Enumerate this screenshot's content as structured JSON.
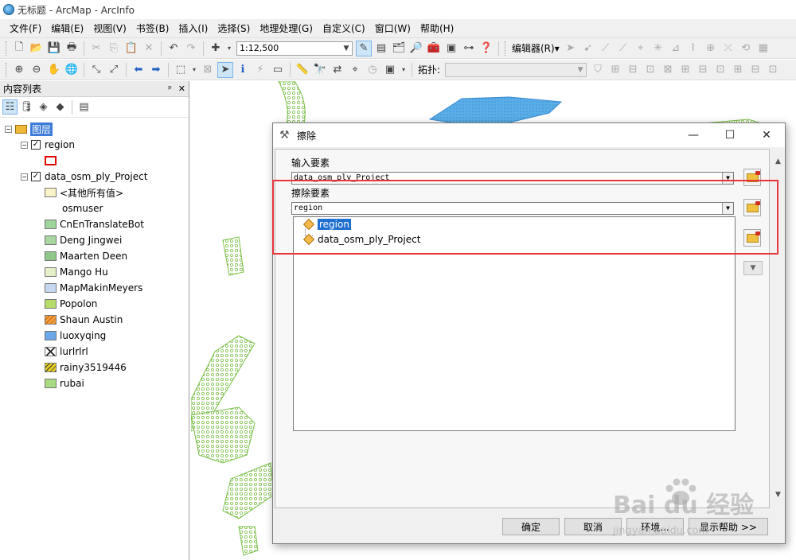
{
  "window": {
    "title": "无标题 - ArcMap - ArcInfo"
  },
  "menubar": {
    "items": [
      "文件(F)",
      "编辑(E)",
      "视图(V)",
      "书签(B)",
      "插入(I)",
      "选择(S)",
      "地理处理(G)",
      "自定义(C)",
      "窗口(W)",
      "帮助(H)"
    ]
  },
  "toolbar": {
    "scale_value": "1:12,500",
    "editor_label": "编辑器(R)▾",
    "topology_label": "拓扑:"
  },
  "toc": {
    "title": "内容列表",
    "pin_glyph": "ᵖ",
    "close_glyph": "✕",
    "root_label": "图层",
    "layer1": "region",
    "layer2": "data_osm_ply_Project",
    "other_values": "<其他所有值>",
    "field_name": "osmuser",
    "legend": [
      {
        "label": "CnEnTranslateBot",
        "color": "#9fd49a"
      },
      {
        "label": "Deng Jingwei",
        "color": "#a8d8a0"
      },
      {
        "label": "Maarten Deen",
        "color": "#8fc98a"
      },
      {
        "label": "Mango Hu",
        "color": "#e6f0c8"
      },
      {
        "label": "MapMakinMeyers",
        "color": "#c5d8f0"
      },
      {
        "label": "Popolon",
        "color": "#b5dc6a"
      },
      {
        "label": "Shaun Austin",
        "color": "#f0a040"
      },
      {
        "label": "luoxyqing",
        "color": "#6aa8e8"
      },
      {
        "label": "lurlrlrl",
        "color": "#ffffff"
      },
      {
        "label": "rainy3519446",
        "color": "#e8d020"
      },
      {
        "label": "rubai",
        "color": "#a8dc80"
      }
    ]
  },
  "dialog": {
    "title": "擦除",
    "input_label": "输入要素",
    "input_value": "data_osm_ply_Project",
    "erase_label": "擦除要素",
    "erase_value": "region",
    "dropdown_items": [
      "region",
      "data_osm_ply_Project"
    ],
    "buttons": {
      "ok": "确定",
      "cancel": "取消",
      "env": "环境...",
      "help": "显示帮助 >>"
    },
    "controls": {
      "minimize": "—",
      "maximize": "☐",
      "close": "✕"
    }
  },
  "watermark": {
    "main": "Bai du 经验",
    "sub": "jingyan.baidu.com"
  },
  "colors": {
    "highlight": "#e8353a",
    "selection": "#1f6fd0",
    "polygon_green": "#7cc04a",
    "polygon_blue": "#5aaee8"
  }
}
